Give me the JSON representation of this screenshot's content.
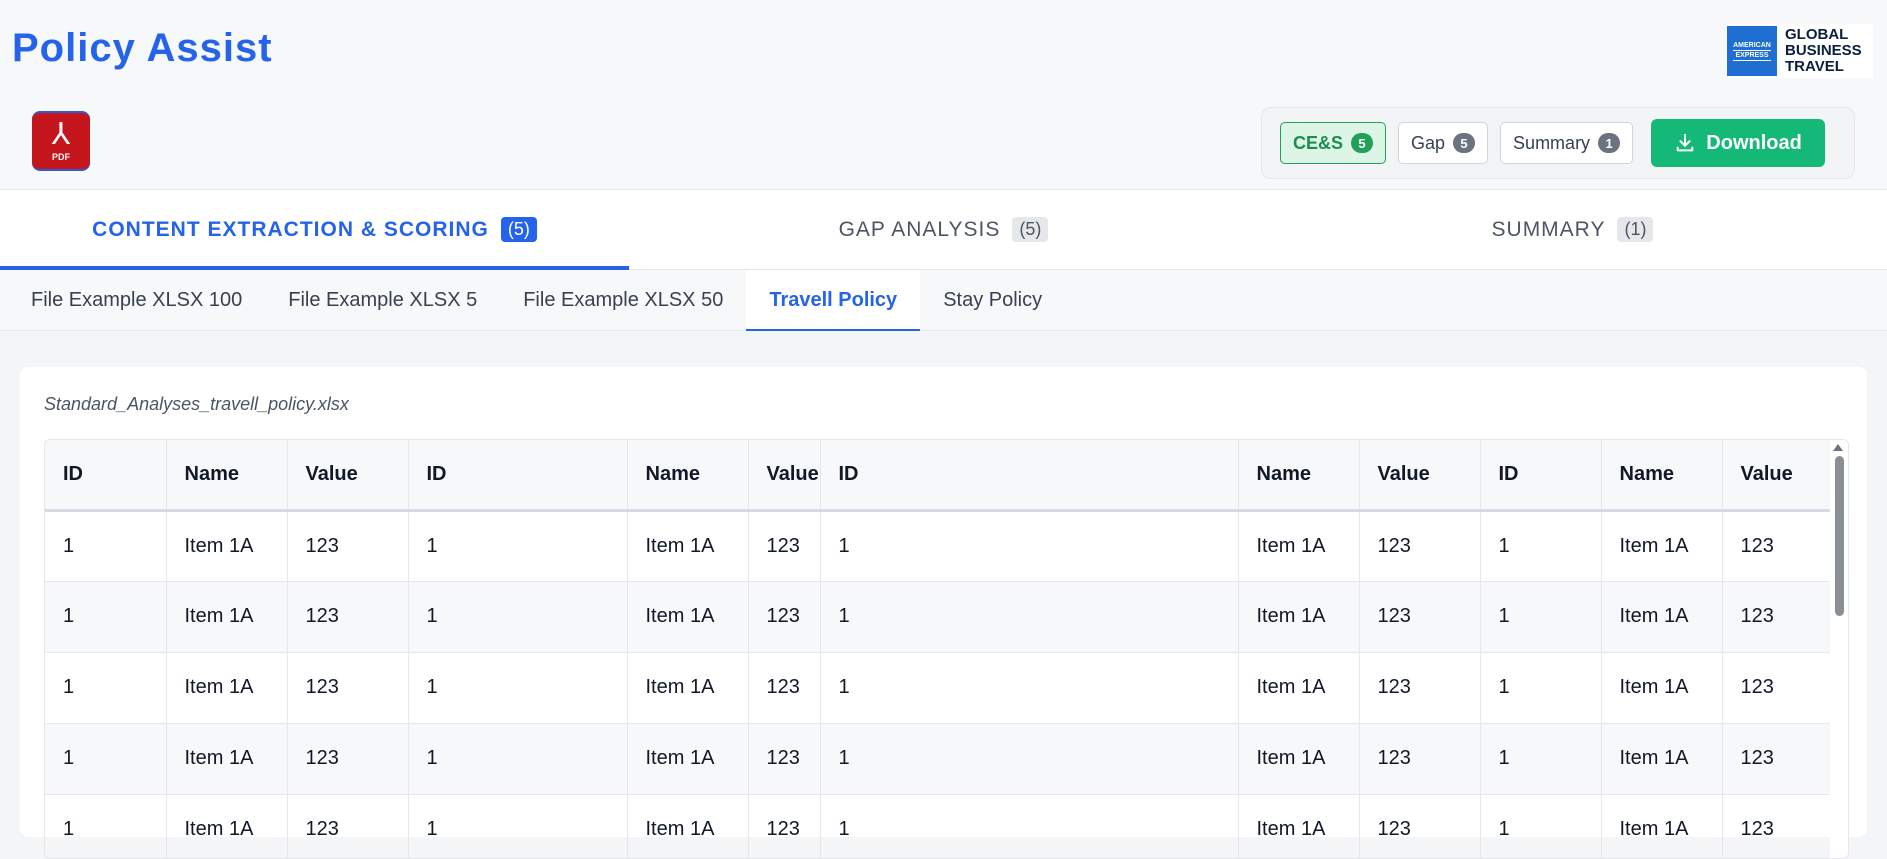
{
  "app": {
    "title": "Policy Assist"
  },
  "brand": {
    "logo_line1": "AMERICAN",
    "logo_line2": "EXPRESS",
    "line1": "GLOBAL",
    "line2": "BUSINESS",
    "line3": "TRAVEL"
  },
  "pdf_icon": {
    "label": "PDF"
  },
  "actions": {
    "ces_label": "CE&S",
    "ces_count": "5",
    "gap_label": "Gap",
    "gap_count": "5",
    "summary_label": "Summary",
    "summary_count": "1",
    "download_label": "Download"
  },
  "main_tabs": [
    {
      "label": "CONTENT EXTRACTION & SCORING",
      "count": "(5)"
    },
    {
      "label": "GAP ANALYSIS",
      "count": "(5)"
    },
    {
      "label": "SUMMARY",
      "count": "(1)"
    }
  ],
  "sub_tabs": [
    {
      "label": "File Example XLSX 100"
    },
    {
      "label": "File Example XLSX 5"
    },
    {
      "label": "File Example XLSX 50"
    },
    {
      "label": "Travell Policy"
    },
    {
      "label": "Stay Policy"
    }
  ],
  "file": {
    "name": "Standard_Analyses_travell_policy.xlsx"
  },
  "table": {
    "headers": [
      "ID",
      "Name",
      "Value",
      "ID",
      "Name",
      "Value",
      "ID",
      "Name",
      "Value",
      "ID",
      "Name",
      "Value"
    ],
    "rows": [
      [
        "1",
        "Item 1A",
        "123",
        "1",
        "Item 1A",
        "123",
        "1",
        "Item 1A",
        "123",
        "1",
        "Item 1A",
        "123"
      ],
      [
        "1",
        "Item 1A",
        "123",
        "1",
        "Item 1A",
        "123",
        "1",
        "Item 1A",
        "123",
        "1",
        "Item 1A",
        "123"
      ],
      [
        "1",
        "Item 1A",
        "123",
        "1",
        "Item 1A",
        "123",
        "1",
        "Item 1A",
        "123",
        "1",
        "Item 1A",
        "123"
      ],
      [
        "1",
        "Item 1A",
        "123",
        "1",
        "Item 1A",
        "123",
        "1",
        "Item 1A",
        "123",
        "1",
        "Item 1A",
        "123"
      ],
      [
        "1",
        "Item 1A",
        "123",
        "1",
        "Item 1A",
        "123",
        "1",
        "Item 1A",
        "123",
        "1",
        "Item 1A",
        "123"
      ]
    ]
  },
  "colors": {
    "accent": "#2563eb",
    "success": "#14b877",
    "pdf": "#c4161c"
  }
}
